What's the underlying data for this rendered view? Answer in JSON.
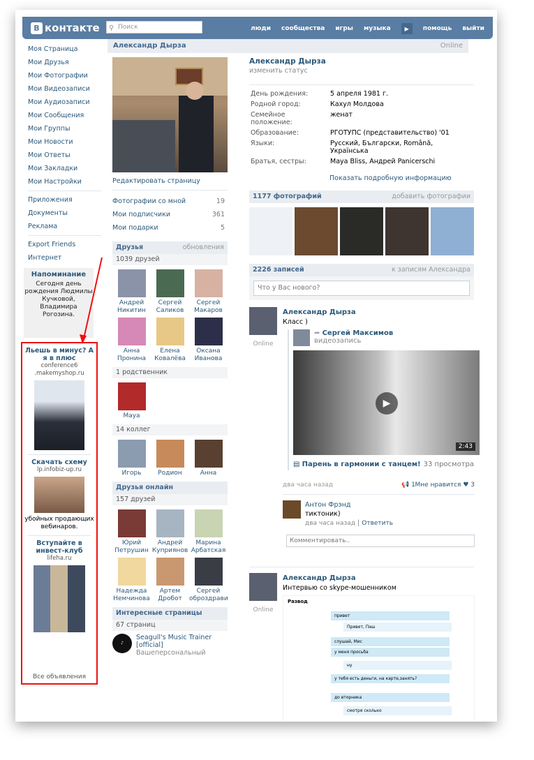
{
  "topbar": {
    "logo": "контакте",
    "logo_badge": "В",
    "search_placeholder": "Поиск",
    "nav": [
      "люди",
      "сообщества",
      "игры",
      "музыка",
      "помощь",
      "выйти"
    ]
  },
  "leftnav": {
    "group1": [
      "Моя Страница",
      "Мои Друзья",
      "Мои Фотографии",
      "Мои Видеозаписи",
      "Мои Аудиозаписи",
      "Мои Сообщения",
      "Мои Группы",
      "Мои Новости",
      "Мои Ответы",
      "Мои Закладки",
      "Мои Настройки"
    ],
    "group2": [
      "Приложения",
      "Документы",
      "Реклама"
    ],
    "group3": [
      "Export Friends",
      "Интернет"
    ]
  },
  "reminder": {
    "title": "Напоминание",
    "text": "Сегодня день рождения Людмилы Кучковой, Владимира Рогозина."
  },
  "ads": [
    {
      "title": "Льешь в минус? А я в плюс",
      "domain": "conference6 .makemyshop.ru"
    },
    {
      "title": "Скачать схему",
      "domain": "lp.infobiz-up.ru",
      "desc": "убойных продающих вебинаров."
    },
    {
      "title": "Вступайте в инвест-клуб",
      "domain": "lifeha.ru"
    }
  ],
  "all_ads": "Все объявления",
  "profile": {
    "name": "Александр Дырза",
    "status": "Online",
    "change_status": "изменить статус",
    "edit": "Редактировать страницу",
    "info": [
      [
        "День рождения:",
        "5 апреля 1981 г."
      ],
      [
        "Родной город:",
        "Кахул Молдова"
      ],
      [
        "Семейное положение:",
        "женат"
      ],
      [
        "Образование:",
        "РГОТУПС (представительство) '01"
      ],
      [
        "Языки:",
        "Русский, Български, Română, Українська"
      ],
      [
        "Братья, сестры:",
        "Maya Bliss, Андрей Panicerschi"
      ]
    ],
    "show_more": "Показать подробную информацию",
    "counters": [
      [
        "Фотографии со мной",
        "19"
      ],
      [
        "Мои подписчики",
        "361"
      ],
      [
        "Мои подарки",
        "5"
      ]
    ]
  },
  "friends": {
    "title": "Друзья",
    "updates": "обновления",
    "count": "1039 друзей",
    "list": [
      "Андрей Никитин",
      "Сергей Саликов",
      "Сергей Макаров",
      "Анна Пронина",
      "Елена Ковалёва",
      "Оксана Иванова"
    ],
    "relatives": "1 родственник",
    "relative": "Maya",
    "colleagues": "14 коллег",
    "colleague_list": [
      "Игорь",
      "Родион",
      "Анна"
    ]
  },
  "online": {
    "title": "Друзья онлайн",
    "count": "157 друзей",
    "list": [
      "Юрий Петрушин",
      "Андрей Куприянов",
      "Марина Арбатская",
      "Надежда Немчинова",
      "Артем Дробот",
      "Сергей оброздрави"
    ]
  },
  "pages": {
    "title": "Интересные страницы",
    "count": "67 страниц",
    "item": "Seagull's Music Trainer [official]",
    "item2": "Вашеперсональный"
  },
  "photos": {
    "count": "1177 фотографий",
    "add": "добавить фотографии"
  },
  "wall": {
    "count": "2226 записей",
    "to_posts": "к записям Александра",
    "placeholder": "Что у Вас нового?"
  },
  "post1": {
    "author": "Александр Дырза",
    "text": "Класс )",
    "online": "Online",
    "repost_author": "Сергей Максимов",
    "repost_type": "видеозапись",
    "duration": "2:43",
    "video_title": "Парень в гармонии с танцем!",
    "views": "33 просмотра",
    "time": "два часа назад",
    "reposts": "1",
    "likes_label": "Мне нравится",
    "likes": "3"
  },
  "comment1": {
    "author": "Антон Фрэнд",
    "text": "тиктоник)",
    "time": "два часа назад",
    "reply": "Ответить"
  },
  "comment_placeholder": "Комментировать..",
  "post2": {
    "author": "Александр Дырза",
    "text": "Интервью со skype-мошенником",
    "online": "Online",
    "chat_header": "Развод",
    "messages": [
      "привет",
      "Привет, Паш",
      "слушай, Мис",
      "у меня просьба",
      "ну",
      "у тебя есть деньги, на карте,занять?",
      "до вторника",
      "смотря сколько"
    ]
  }
}
